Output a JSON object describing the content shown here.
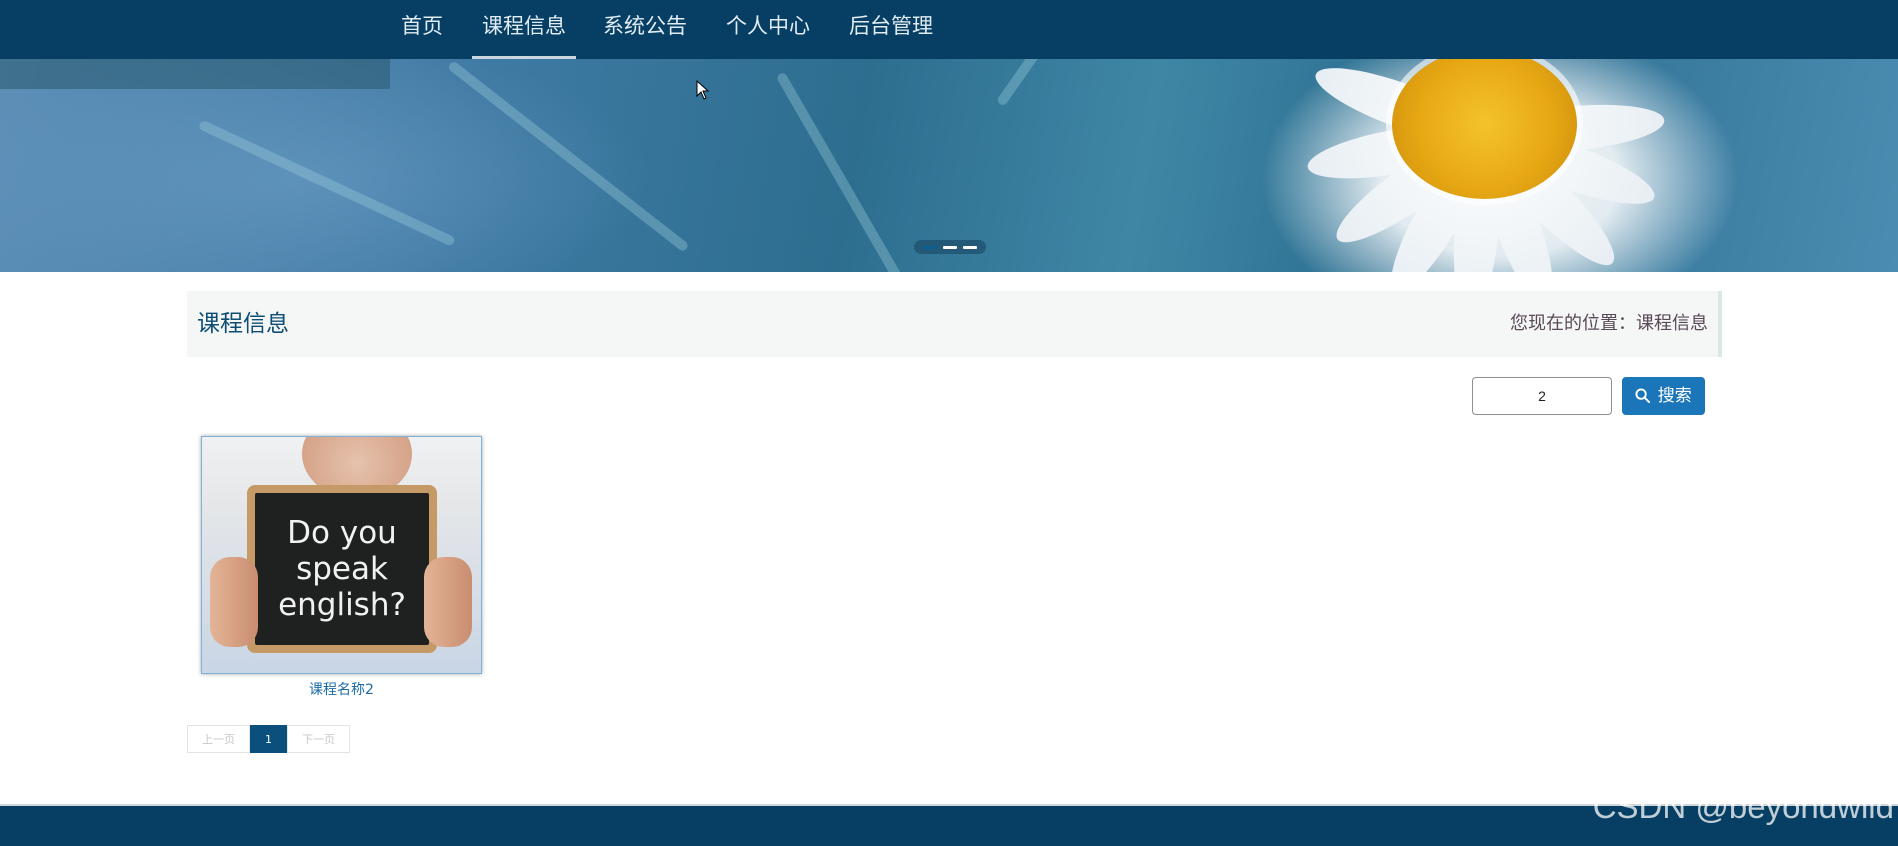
{
  "nav": {
    "items": [
      {
        "label": "首页"
      },
      {
        "label": "课程信息"
      },
      {
        "label": "系统公告"
      },
      {
        "label": "个人中心"
      },
      {
        "label": "后台管理"
      }
    ],
    "active_index": 1
  },
  "banner": {
    "slides_count": 3,
    "active_slide": 0
  },
  "section": {
    "title": "课程信息",
    "location": "您现在的位置：课程信息"
  },
  "search": {
    "value": "2",
    "button_label": "搜索",
    "button_icon": "search-icon"
  },
  "courses": [
    {
      "name": "课程名称2",
      "image_text": [
        "Do you",
        "speak",
        "english?"
      ]
    }
  ],
  "pagination": {
    "prev_label": "上一页",
    "current_page": "1",
    "next_label": "下一页"
  },
  "watermark": "CSDN @beyondwild",
  "colors": {
    "nav_bg": "#063f63",
    "accent": "#1b75b9",
    "title": "#0f4e74"
  }
}
